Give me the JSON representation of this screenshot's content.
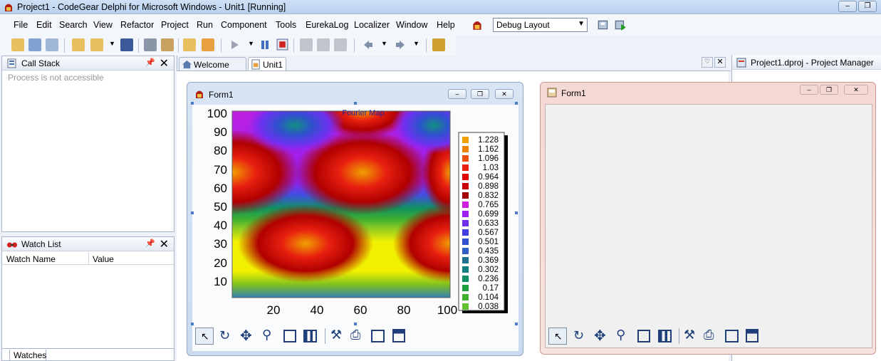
{
  "window": {
    "title": "Project1 - CodeGear Delphi for Microsoft Windows - Unit1 [Running]",
    "buttons": {
      "minimize": "‒",
      "restore": "❐"
    }
  },
  "menu": [
    "File",
    "Edit",
    "Search",
    "View",
    "Refactor",
    "Project",
    "Run",
    "Component",
    "Tools",
    "EurekaLog",
    "Localizer",
    "Window",
    "Help"
  ],
  "layout_combo": {
    "value": "Debug Layout"
  },
  "call_stack": {
    "title": "Call Stack",
    "message": "Process is not accessible"
  },
  "watch_list": {
    "title": "Watch List",
    "columns": [
      "Watch Name",
      "Value"
    ],
    "tab": "Watches"
  },
  "editor_tabs": [
    "Welcome Page",
    "Unit1"
  ],
  "project_manager": {
    "title": "Project1.dproj - Project Manager"
  },
  "form_designer": {
    "title": "Form1"
  },
  "running_form": {
    "title": "Form1"
  },
  "chart_data": {
    "type": "heatmap",
    "title": "Fourier Map",
    "x_ticks": [
      "20",
      "40",
      "60",
      "80",
      "100"
    ],
    "y_ticks": [
      "100",
      "90",
      "80",
      "70",
      "60",
      "50",
      "40",
      "30",
      "20",
      "10"
    ],
    "xlim": [
      0,
      100
    ],
    "ylim": [
      0,
      100
    ],
    "legend": [
      {
        "label": "1.228",
        "color": "#f0a000"
      },
      {
        "label": "1.162",
        "color": "#f08000"
      },
      {
        "label": "1.096",
        "color": "#f05010"
      },
      {
        "label": "1.03",
        "color": "#e82010"
      },
      {
        "label": "0.964",
        "color": "#e00000"
      },
      {
        "label": "0.898",
        "color": "#c80000"
      },
      {
        "label": "0.832",
        "color": "#a00000"
      },
      {
        "label": "0.765",
        "color": "#d020e0"
      },
      {
        "label": "0.699",
        "color": "#a020f0"
      },
      {
        "label": "0.633",
        "color": "#7030f0"
      },
      {
        "label": "0.567",
        "color": "#4040e0"
      },
      {
        "label": "0.501",
        "color": "#3050d0"
      },
      {
        "label": "0.435",
        "color": "#3060c8"
      },
      {
        "label": "0.369",
        "color": "#207090"
      },
      {
        "label": "0.302",
        "color": "#108080"
      },
      {
        "label": "0.236",
        "color": "#109060"
      },
      {
        "label": "0.17",
        "color": "#20a040"
      },
      {
        "label": "0.104",
        "color": "#40b030"
      },
      {
        "label": "0.038",
        "color": "#60c030"
      }
    ]
  }
}
